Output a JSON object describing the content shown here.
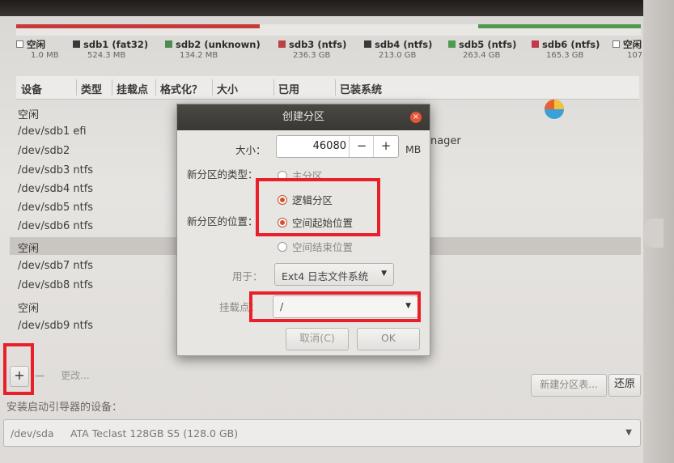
{
  "partition_bar": {
    "segments": [
      {
        "name": "sdb1",
        "color": "#c83a3a",
        "start": 0.0,
        "end": 0.39
      },
      {
        "name": "gap",
        "color": "#e9e7e4",
        "start": 0.39,
        "end": 0.74
      },
      {
        "name": "sdb5",
        "color": "#4f9a4f",
        "start": 0.74,
        "end": 1.0
      }
    ]
  },
  "legend": [
    {
      "name": "空闲",
      "size": "1.0 MB",
      "color": "#ffffff",
      "empty": true
    },
    {
      "name": "sdb1 (fat32)",
      "size": "524.3 MB",
      "color": "#3a3a3a",
      "empty": false
    },
    {
      "name": "sdb2 (unknown)",
      "size": "134.2 MB",
      "color": "#4f8a4f",
      "empty": false
    },
    {
      "name": "sdb3 (ntfs)",
      "size": "236.3 GB",
      "color": "#b84444",
      "empty": false
    },
    {
      "name": "sdb4 (ntfs)",
      "size": "213.0 GB",
      "color": "#3a3a3a",
      "empty": false
    },
    {
      "name": "sdb5 (ntfs)",
      "size": "263.4 GB",
      "color": "#4f9a4f",
      "empty": false
    },
    {
      "name": "sdb6 (ntfs)",
      "size": "165.3 GB",
      "color": "#c23a4a",
      "empty": false
    },
    {
      "name": "空闲",
      "size": "107",
      "color": "#ffffff",
      "empty": true
    }
  ],
  "table": {
    "headers": [
      "设备",
      "类型",
      "挂载点",
      "格式化？",
      "大小",
      "已用",
      "已装系统"
    ],
    "rows": [
      "空闲",
      "/dev/sdb1  efi",
      "/dev/sdb2",
      "/dev/sdb3  ntfs",
      "/dev/sdb4  ntfs",
      "/dev/sdb5  ntfs",
      "/dev/sdb6  ntfs",
      "空闲",
      "/dev/sdb7  ntfs",
      "/dev/sdb8  ntfs",
      "空闲",
      "/dev/sdb9  ntfs"
    ],
    "selected_index": 7,
    "background_text": "anager"
  },
  "toolbar": {
    "add": "+",
    "remove": "—",
    "change": "更改...",
    "new_table": "新建分区表...",
    "revert": "还原"
  },
  "bootloader": {
    "label": "安装启动引导器的设备：",
    "device": "/dev/sda",
    "description": "ATA Teclast 128GB S5 (128.0 GB)"
  },
  "dialog": {
    "title": "创建分区",
    "size_label": "大小：",
    "size_value": "46080",
    "minus": "−",
    "plus": "+",
    "size_unit": "MB",
    "type_label": "新分区的类型：",
    "type_primary": "主分区",
    "type_logical": "逻辑分区",
    "location_label": "新分区的位置：",
    "location_start": "空间起始位置",
    "location_end": "空间结束位置",
    "use_label": "用于：",
    "use_value": "Ext4 日志文件系统",
    "mount_label": "挂载点：",
    "mount_value": "/",
    "cancel": "取消(C)",
    "ok": "OK",
    "close": "×"
  }
}
